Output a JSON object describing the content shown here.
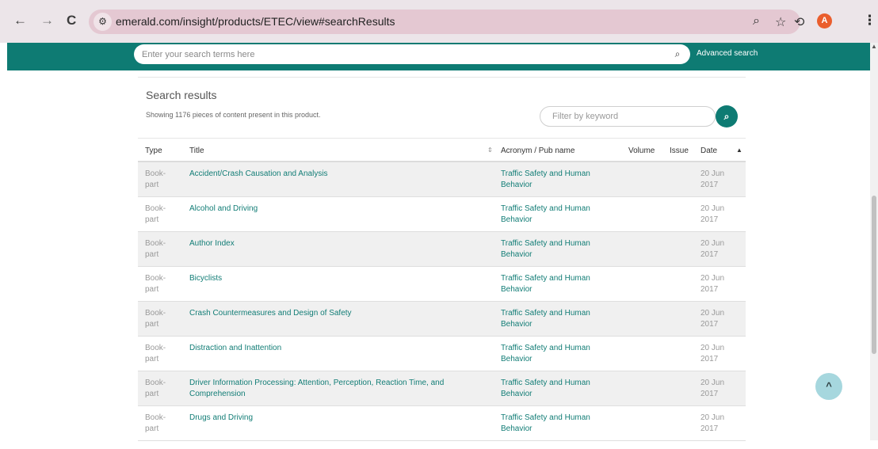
{
  "browser": {
    "back": "←",
    "forward": "→",
    "reload": "C",
    "site_info_glyph": "⚙",
    "url": "emerald.com/insight/products/ETEC/view#searchResults",
    "zoom_glyph": "⌕",
    "bookmark_glyph": "☆",
    "extension_glyph": "⟲",
    "profile_initial": "A",
    "menu_glyph": "⋮"
  },
  "header": {
    "search_placeholder": "Enter your search terms here",
    "search_glyph": "⌕",
    "advanced_search": "Advanced search"
  },
  "results": {
    "title": "Search results",
    "count_text": "Showing 1176 pieces of content present in this product.",
    "filter_placeholder": "Filter by keyword",
    "filter_glyph": "⌕"
  },
  "table": {
    "columns": {
      "type": "Type",
      "title": "Title",
      "pub": "Acronym / Pub name",
      "volume": "Volume",
      "issue": "Issue",
      "date": "Date"
    },
    "sort_glyph": "⇕",
    "date_sort_glyph": "▲",
    "rows": [
      {
        "type": "Book-part",
        "title": "Accident/Crash Causation and Analysis",
        "pub": "Traffic Safety and Human Behavior",
        "date": "20 Jun 2017"
      },
      {
        "type": "Book-part",
        "title": "Alcohol and Driving",
        "pub": "Traffic Safety and Human Behavior",
        "date": "20 Jun 2017"
      },
      {
        "type": "Book-part",
        "title": "Author Index",
        "pub": "Traffic Safety and Human Behavior",
        "date": "20 Jun 2017"
      },
      {
        "type": "Book-part",
        "title": "Bicyclists",
        "pub": "Traffic Safety and Human Behavior",
        "date": "20 Jun 2017"
      },
      {
        "type": "Book-part",
        "title": "Crash Countermeasures and Design of Safety",
        "pub": "Traffic Safety and Human Behavior",
        "date": "20 Jun 2017"
      },
      {
        "type": "Book-part",
        "title": "Distraction and Inattention",
        "pub": "Traffic Safety and Human Behavior",
        "date": "20 Jun 2017"
      },
      {
        "type": "Book-part",
        "title": "Driver Information Processing: Attention, Perception, Reaction Time, and Comprehension",
        "pub": "Traffic Safety and Human Behavior",
        "date": "20 Jun 2017"
      },
      {
        "type": "Book-part",
        "title": "Drugs and Driving",
        "pub": "Traffic Safety and Human Behavior",
        "date": "20 Jun 2017"
      }
    ]
  },
  "back_to_top_glyph": "^",
  "colors": {
    "brand_teal": "#0e7b73",
    "link": "#127d76"
  }
}
